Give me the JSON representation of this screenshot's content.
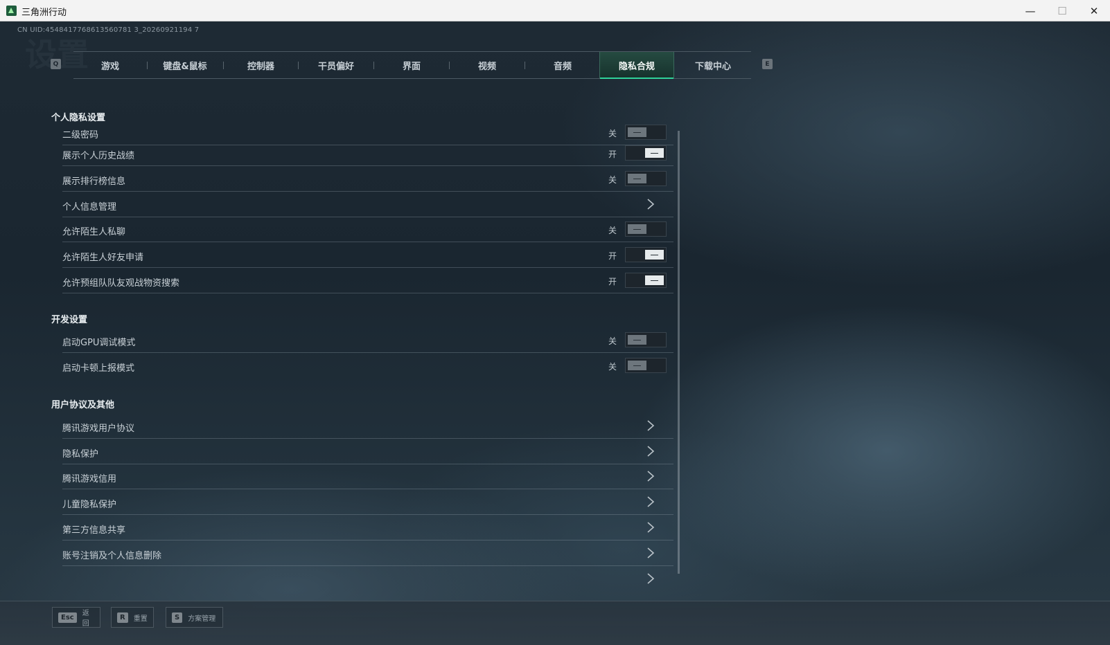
{
  "window": {
    "title": "三角洲行动",
    "minimize": "—",
    "maximize": "☐",
    "close": "✕"
  },
  "uid": "CN UID:4548417768613560781 3_20260921194 7",
  "ghost_title": "设置",
  "tabs": {
    "prev_key": "Q",
    "next_key": "E",
    "items": [
      {
        "label": "游戏"
      },
      {
        "label": "键盘&鼠标"
      },
      {
        "label": "控制器"
      },
      {
        "label": "干员偏好"
      },
      {
        "label": "界面"
      },
      {
        "label": "视频"
      },
      {
        "label": "音频"
      },
      {
        "label": "隐私合规",
        "active": true
      },
      {
        "label": "下载中心"
      }
    ]
  },
  "sections": {
    "privacy": {
      "title": "个人隐私设置",
      "rows": [
        {
          "label": "二级密码",
          "state": "关"
        },
        {
          "label": "展示个人历史战绩",
          "state": "开"
        },
        {
          "label": "展示排行榜信息",
          "state": "关"
        },
        {
          "label": "个人信息管理"
        },
        {
          "label": "允许陌生人私聊",
          "state": "关"
        },
        {
          "label": "允许陌生人好友申请",
          "state": "开"
        },
        {
          "label": "允许预组队队友观战物资搜索",
          "state": "开"
        }
      ]
    },
    "dev": {
      "title": "开发设置",
      "rows": [
        {
          "label": "启动GPU调试模式",
          "state": "关"
        },
        {
          "label": "启动卡顿上报模式",
          "state": "关"
        }
      ]
    },
    "agreements": {
      "title": "用户协议及其他",
      "rows": [
        {
          "label": "腾讯游戏用户协议"
        },
        {
          "label": "隐私保护"
        },
        {
          "label": "腾讯游戏信用"
        },
        {
          "label": "儿童隐私保护"
        },
        {
          "label": "第三方信息共享"
        },
        {
          "label": "账号注销及个人信息删除"
        }
      ]
    }
  },
  "bottom_bar": {
    "back": {
      "key": "Esc",
      "label": "返回"
    },
    "reset": {
      "key": "R",
      "label": "重置"
    },
    "scheme": {
      "key": "S",
      "label": "方案管理"
    }
  },
  "colors": {
    "accent": "#2fd39a",
    "active_tab_bg": "#1f4a40"
  }
}
